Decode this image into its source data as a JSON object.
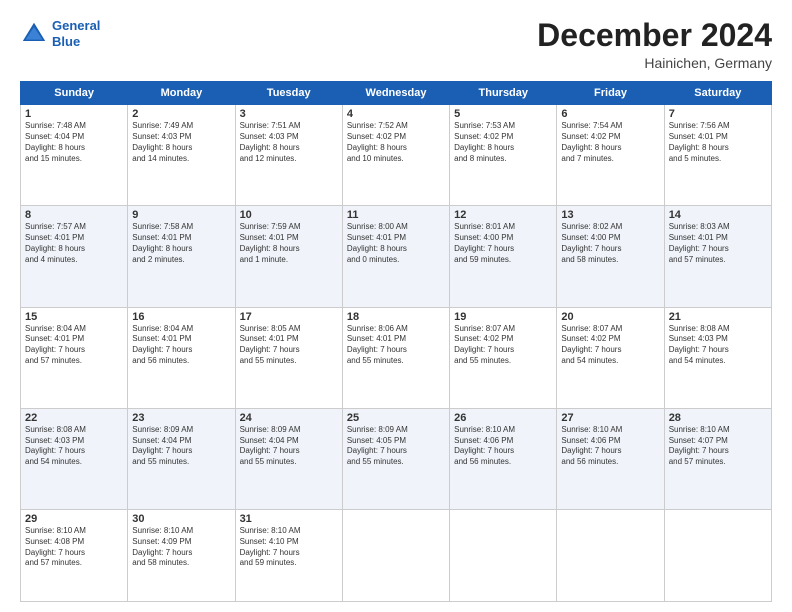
{
  "header": {
    "logo_line1": "General",
    "logo_line2": "Blue",
    "title": "December 2024",
    "subtitle": "Hainichen, Germany"
  },
  "days_of_week": [
    "Sunday",
    "Monday",
    "Tuesday",
    "Wednesday",
    "Thursday",
    "Friday",
    "Saturday"
  ],
  "weeks": [
    [
      {
        "day": 1,
        "info": "Sunrise: 7:48 AM\nSunset: 4:04 PM\nDaylight: 8 hours\nand 15 minutes."
      },
      {
        "day": 2,
        "info": "Sunrise: 7:49 AM\nSunset: 4:03 PM\nDaylight: 8 hours\nand 14 minutes."
      },
      {
        "day": 3,
        "info": "Sunrise: 7:51 AM\nSunset: 4:03 PM\nDaylight: 8 hours\nand 12 minutes."
      },
      {
        "day": 4,
        "info": "Sunrise: 7:52 AM\nSunset: 4:02 PM\nDaylight: 8 hours\nand 10 minutes."
      },
      {
        "day": 5,
        "info": "Sunrise: 7:53 AM\nSunset: 4:02 PM\nDaylight: 8 hours\nand 8 minutes."
      },
      {
        "day": 6,
        "info": "Sunrise: 7:54 AM\nSunset: 4:02 PM\nDaylight: 8 hours\nand 7 minutes."
      },
      {
        "day": 7,
        "info": "Sunrise: 7:56 AM\nSunset: 4:01 PM\nDaylight: 8 hours\nand 5 minutes."
      }
    ],
    [
      {
        "day": 8,
        "info": "Sunrise: 7:57 AM\nSunset: 4:01 PM\nDaylight: 8 hours\nand 4 minutes."
      },
      {
        "day": 9,
        "info": "Sunrise: 7:58 AM\nSunset: 4:01 PM\nDaylight: 8 hours\nand 2 minutes."
      },
      {
        "day": 10,
        "info": "Sunrise: 7:59 AM\nSunset: 4:01 PM\nDaylight: 8 hours\nand 1 minute."
      },
      {
        "day": 11,
        "info": "Sunrise: 8:00 AM\nSunset: 4:01 PM\nDaylight: 8 hours\nand 0 minutes."
      },
      {
        "day": 12,
        "info": "Sunrise: 8:01 AM\nSunset: 4:00 PM\nDaylight: 7 hours\nand 59 minutes."
      },
      {
        "day": 13,
        "info": "Sunrise: 8:02 AM\nSunset: 4:00 PM\nDaylight: 7 hours\nand 58 minutes."
      },
      {
        "day": 14,
        "info": "Sunrise: 8:03 AM\nSunset: 4:01 PM\nDaylight: 7 hours\nand 57 minutes."
      }
    ],
    [
      {
        "day": 15,
        "info": "Sunrise: 8:04 AM\nSunset: 4:01 PM\nDaylight: 7 hours\nand 57 minutes."
      },
      {
        "day": 16,
        "info": "Sunrise: 8:04 AM\nSunset: 4:01 PM\nDaylight: 7 hours\nand 56 minutes."
      },
      {
        "day": 17,
        "info": "Sunrise: 8:05 AM\nSunset: 4:01 PM\nDaylight: 7 hours\nand 55 minutes."
      },
      {
        "day": 18,
        "info": "Sunrise: 8:06 AM\nSunset: 4:01 PM\nDaylight: 7 hours\nand 55 minutes."
      },
      {
        "day": 19,
        "info": "Sunrise: 8:07 AM\nSunset: 4:02 PM\nDaylight: 7 hours\nand 55 minutes."
      },
      {
        "day": 20,
        "info": "Sunrise: 8:07 AM\nSunset: 4:02 PM\nDaylight: 7 hours\nand 54 minutes."
      },
      {
        "day": 21,
        "info": "Sunrise: 8:08 AM\nSunset: 4:03 PM\nDaylight: 7 hours\nand 54 minutes."
      }
    ],
    [
      {
        "day": 22,
        "info": "Sunrise: 8:08 AM\nSunset: 4:03 PM\nDaylight: 7 hours\nand 54 minutes."
      },
      {
        "day": 23,
        "info": "Sunrise: 8:09 AM\nSunset: 4:04 PM\nDaylight: 7 hours\nand 55 minutes."
      },
      {
        "day": 24,
        "info": "Sunrise: 8:09 AM\nSunset: 4:04 PM\nDaylight: 7 hours\nand 55 minutes."
      },
      {
        "day": 25,
        "info": "Sunrise: 8:09 AM\nSunset: 4:05 PM\nDaylight: 7 hours\nand 55 minutes."
      },
      {
        "day": 26,
        "info": "Sunrise: 8:10 AM\nSunset: 4:06 PM\nDaylight: 7 hours\nand 56 minutes."
      },
      {
        "day": 27,
        "info": "Sunrise: 8:10 AM\nSunset: 4:06 PM\nDaylight: 7 hours\nand 56 minutes."
      },
      {
        "day": 28,
        "info": "Sunrise: 8:10 AM\nSunset: 4:07 PM\nDaylight: 7 hours\nand 57 minutes."
      }
    ],
    [
      {
        "day": 29,
        "info": "Sunrise: 8:10 AM\nSunset: 4:08 PM\nDaylight: 7 hours\nand 57 minutes."
      },
      {
        "day": 30,
        "info": "Sunrise: 8:10 AM\nSunset: 4:09 PM\nDaylight: 7 hours\nand 58 minutes."
      },
      {
        "day": 31,
        "info": "Sunrise: 8:10 AM\nSunset: 4:10 PM\nDaylight: 7 hours\nand 59 minutes."
      },
      null,
      null,
      null,
      null
    ]
  ]
}
